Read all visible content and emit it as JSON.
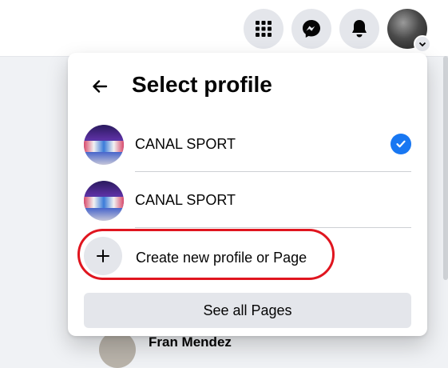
{
  "background_name": "Fran Mendez",
  "menu": {
    "title": "Select profile",
    "profiles": [
      {
        "name": "CANAL SPORT",
        "selected": true
      },
      {
        "name": "CANAL SPORT",
        "selected": false
      }
    ],
    "create_label": "Create new profile or Page",
    "see_all_label": "See all Pages"
  },
  "colors": {
    "accent": "#1877f2",
    "highlight_ellipse": "#e0151f",
    "button_bg": "#e4e6eb"
  },
  "icons": {
    "menu": "grid-menu-icon",
    "messenger": "messenger-icon",
    "notifications": "bell-icon",
    "back": "arrow-left-icon",
    "check": "check-icon",
    "create": "plus-icon"
  }
}
